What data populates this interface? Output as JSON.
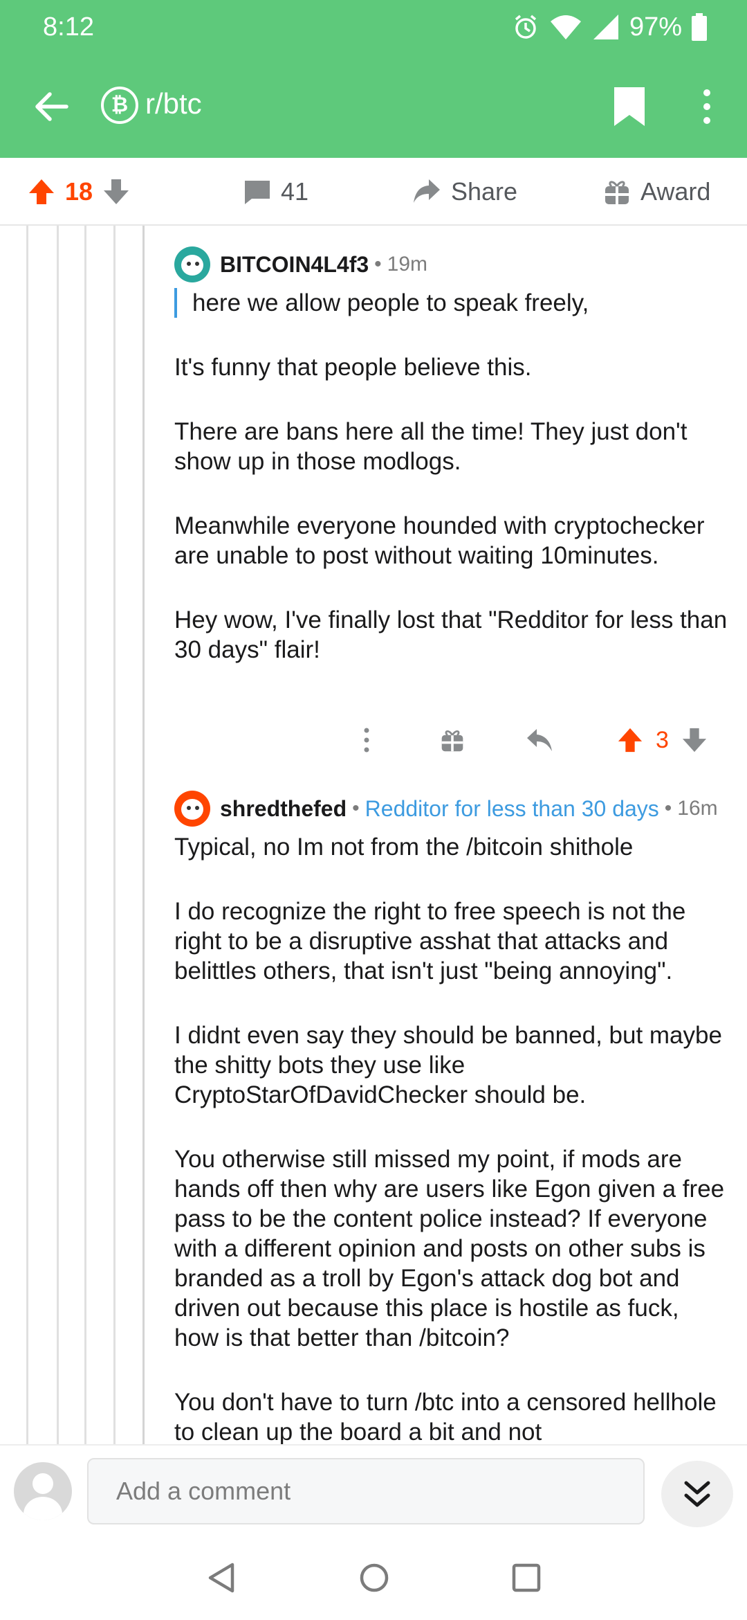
{
  "status_bar": {
    "time": "8:12",
    "battery": "97%"
  },
  "app_bar": {
    "subreddit": "r/btc",
    "badge_glyph": "₿"
  },
  "post_actions": {
    "upvotes": "18",
    "comments": "41",
    "share": "Share",
    "award": "Award"
  },
  "comments": [
    {
      "user": "BITCOIN4L4f3",
      "time": "19m",
      "quote": "here we allow people to speak freely,",
      "paragraphs": [
        "It's funny that people believe this.",
        "There are bans here all the time! They just don't show up in those modlogs.",
        "Meanwhile everyone hounded with cryptochecker are unable to post without waiting 10minutes.",
        "Hey wow, I've finally lost that \"Redditor for less than 30 days\" flair!"
      ],
      "score": "3"
    },
    {
      "user": "shredthefed",
      "flair": "Redditor for less than 30 days",
      "time": "16m",
      "paragraphs": [
        "Typical, no Im not from the /bitcoin shithole",
        "I do recognize the right to free speech is not the right to be a disruptive asshat that attacks and belittles others, that isn't just \"being annoying\".",
        "I didnt even say they should be banned, but maybe the shitty bots they use like CryptoStarOfDavidChecker should be.",
        "You otherwise still missed my point, if mods are hands off then why are users like Egon given a free pass to be the content police instead? If everyone with a different opinion and posts on other subs is branded as a troll by Egon's attack dog bot and driven out because this place is hostile as fuck, how is that better than /bitcoin?",
        "You don't have to turn /btc into a censored hellhole to clean up the board a bit and not"
      ]
    }
  ],
  "comment_bar": {
    "placeholder": "Add a comment"
  },
  "colors": {
    "header": "#5ec97b",
    "upvote": "#ff4500",
    "flair": "#3d9be0",
    "quote_bar": "#3d9be0"
  }
}
